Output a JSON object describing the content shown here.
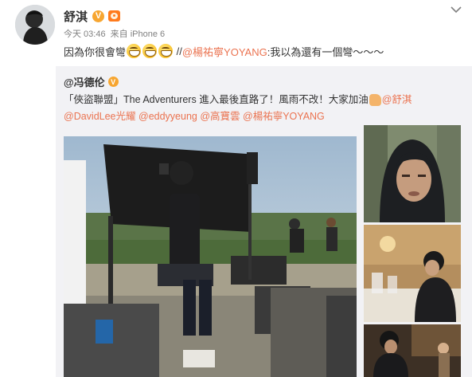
{
  "post": {
    "username": "舒淇",
    "verified_symbol": "V",
    "time": "今天 03:46",
    "source_prefix": "来自",
    "source": "iPhone 6",
    "text_before": "因為你很會彎",
    "emoji_name": "grin-emoji",
    "emoji_count": 3,
    "text_separator": " //",
    "mention": "@楊祐寧YOYANG",
    "text_after": ":我以為還有一個彎～～～"
  },
  "repost": {
    "author": "@冯德伦",
    "verified_symbol": "V",
    "line1_text": "「俠盜聯盟」The Adventurers 進入最後直路了！風雨不改！大家加油",
    "hand_emoji_name": "fist-emoji",
    "mention_1": "@舒淇",
    "mention_2": "@DavidLee光耀",
    "mention_3": "@eddyyeung",
    "mention_4": "@高寶雲",
    "mention_5": "@楊祐寧YOYANG"
  },
  "images": {
    "main": "film-set-photo",
    "thumb_1": "hooded-actor-closeup-photo",
    "thumb_2": "restaurant-scene-photo",
    "thumb_3": "hotel-lobby-scene-photo"
  },
  "colors": {
    "link": "#eb7350",
    "repost_background": "#f2f2f5",
    "meta_text": "#808080",
    "verified_badge": "#f7a631"
  }
}
